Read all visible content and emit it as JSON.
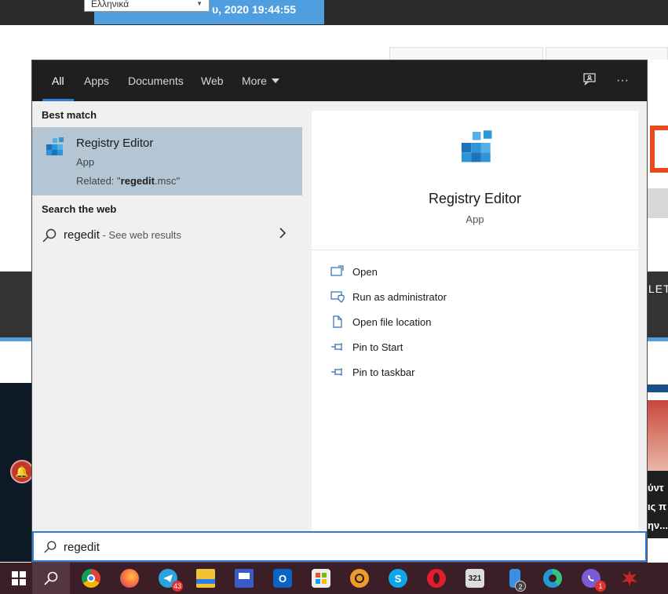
{
  "background": {
    "datetime": "υ, 2020   19:44:55",
    "language": "Ελληνικά",
    "band_text": "LET",
    "side_text": [
      "ύντ",
      "ις π",
      "ην..."
    ]
  },
  "search": {
    "tabs": [
      {
        "label": "All",
        "active": true
      },
      {
        "label": "Apps",
        "active": false
      },
      {
        "label": "Documents",
        "active": false
      },
      {
        "label": "Web",
        "active": false
      },
      {
        "label": "More",
        "active": false
      }
    ],
    "best_match_label": "Best match",
    "best_match": {
      "title": "Registry Editor",
      "type": "App",
      "related_prefix": "Related: \"",
      "related_bold": "regedit",
      "related_suffix": ".msc\""
    },
    "web_label": "Search the web",
    "web_result": {
      "query": "regedit",
      "suffix": " - See web results"
    },
    "preview": {
      "title": "Registry Editor",
      "type": "App",
      "actions": [
        {
          "label": "Open",
          "icon": "open-icon"
        },
        {
          "label": "Run as administrator",
          "icon": "shield-icon"
        },
        {
          "label": "Open file location",
          "icon": "file-location-icon"
        },
        {
          "label": "Pin to Start",
          "icon": "pin-icon"
        },
        {
          "label": "Pin to taskbar",
          "icon": "pin-icon"
        }
      ]
    },
    "query": "regedit"
  },
  "taskbar": {
    "items": [
      {
        "name": "start-button",
        "icon": "windows-icon"
      },
      {
        "name": "search-button",
        "icon": "search-icon",
        "active": true
      },
      {
        "name": "chrome",
        "icon": "chrome-icon",
        "color": "#4caf50"
      },
      {
        "name": "firefox",
        "icon": "firefox-icon",
        "color": "#ff7139"
      },
      {
        "name": "telegram",
        "icon": "telegram-icon",
        "color": "#2aa3df",
        "badge": "43"
      },
      {
        "name": "file-explorer",
        "icon": "folder-icon",
        "color": "#f3c335"
      },
      {
        "name": "floppy",
        "icon": "save-icon",
        "color": "#3b5bc6"
      },
      {
        "name": "outlook",
        "icon": "outlook-icon",
        "color": "#0a64c4"
      },
      {
        "name": "store",
        "icon": "store-icon",
        "color": "#efefef"
      },
      {
        "name": "vlc-like",
        "icon": "media-icon",
        "color": "#f19a2c"
      },
      {
        "name": "skype",
        "icon": "skype-icon",
        "color": "#0ea5e9"
      },
      {
        "name": "opera",
        "icon": "opera-icon",
        "color": "#e21d2c"
      },
      {
        "name": "video-editor",
        "icon": "clapper-icon",
        "color": "#dddddd"
      },
      {
        "name": "phone-app",
        "icon": "phone-icon",
        "color": "#3a8ee6",
        "badge": "2"
      },
      {
        "name": "edge",
        "icon": "edge-icon",
        "color": "#1f9ad6"
      },
      {
        "name": "viber",
        "icon": "viber-icon",
        "color": "#7b5bd1",
        "badge": "1"
      },
      {
        "name": "game-app",
        "icon": "splat-icon",
        "color": "#c62828"
      }
    ]
  }
}
